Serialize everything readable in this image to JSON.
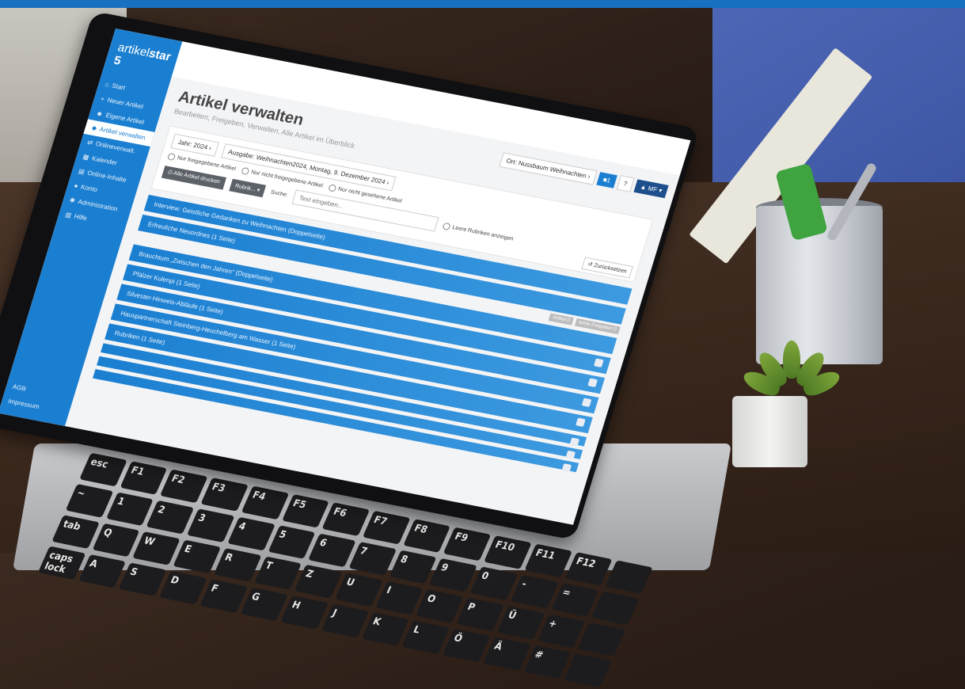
{
  "brand": {
    "name_light": "artikel",
    "name_bold": "star 5"
  },
  "sidebar": {
    "items": [
      {
        "label": "Start",
        "icon": "home-icon"
      },
      {
        "label": "Neuer Artikel",
        "icon": "plus-icon"
      },
      {
        "label": "Eigene Artikel",
        "icon": "users-icon"
      },
      {
        "label": "Artikel verwalten",
        "icon": "tag-icon"
      },
      {
        "label": "Onlineverwalt.",
        "icon": "shuffle-icon"
      },
      {
        "label": "Kalender",
        "icon": "calendar-icon"
      },
      {
        "label": "Online-Inhalte",
        "icon": "file-icon"
      },
      {
        "label": "Konto",
        "icon": "user-icon"
      },
      {
        "label": "Administration",
        "icon": "settings-icon"
      },
      {
        "label": "Hilfe",
        "icon": "book-icon"
      }
    ],
    "footer": [
      {
        "label": "AGB"
      },
      {
        "label": "Impressum"
      }
    ]
  },
  "page": {
    "title": "Artikel verwalten",
    "subtitle": "Bearbeiten, Freigeben, Verwalten, Alle Artikel im Überblick"
  },
  "header_tools": {
    "ort": "Ort: Nussbaum Weihnachten",
    "chevron": "›",
    "blue_btn": "■1",
    "help": "?",
    "user": "▲ MF ▾"
  },
  "filters": {
    "year": "Jahr: 2024",
    "year_chevron": "›",
    "ausgabe": "Ausgabe: Weihnachten2024, Montag, 9. Dezember 2024",
    "ausgabe_chevron": "›",
    "radio1": "Nur freigegebene Artikel",
    "radio2": "Nur nicht freigegebene Artikel",
    "radio3": "Nur nicht gesehene Artikel",
    "radio4": "Leere Rubriken anzeigen",
    "print_btn": "Alle Artikel drucken",
    "rubrik_btn": "Rubrik...",
    "search_label": "Suche:",
    "search_placeholder": "Text eingeben...",
    "reset": "Zurücksetzen"
  },
  "articles": [
    "Interview: Geistliche Gedanken zu Weihnachten (Doppelseite)",
    "Erfreuliche Neuordnes (1 Seite)",
    "Brauchtum „Zwischen den Jahren“ (Doppelseite)",
    "Pfälzer Kulenpi (1 Seite)",
    "Silvester-Hinweis-Abläufe (1 Seite)",
    "Hauspartnerschaft Steinberg-Heuchelberg am Wasser (1 Seite)",
    "Rubriken (1 Seite)",
    "",
    "",
    ""
  ],
  "badges": {
    "b1": "Artikel 0",
    "b2": "keine Freigaben 0"
  },
  "keyboard": [
    "esc",
    "F1",
    "F2",
    "F3",
    "F4",
    "F5",
    "F6",
    "F7",
    "F8",
    "F9",
    "F10",
    "F11",
    "F12",
    "",
    "~",
    "1",
    "2",
    "3",
    "4",
    "5",
    "6",
    "7",
    "8",
    "9",
    "0",
    "-",
    "=",
    "",
    "tab",
    "Q",
    "W",
    "E",
    "R",
    "T",
    "Z",
    "U",
    "I",
    "O",
    "P",
    "Ü",
    "+",
    "",
    "caps lock",
    "A",
    "S",
    "D",
    "F",
    "G",
    "H",
    "J",
    "K",
    "L",
    "Ö",
    "Ä",
    "#",
    ""
  ]
}
